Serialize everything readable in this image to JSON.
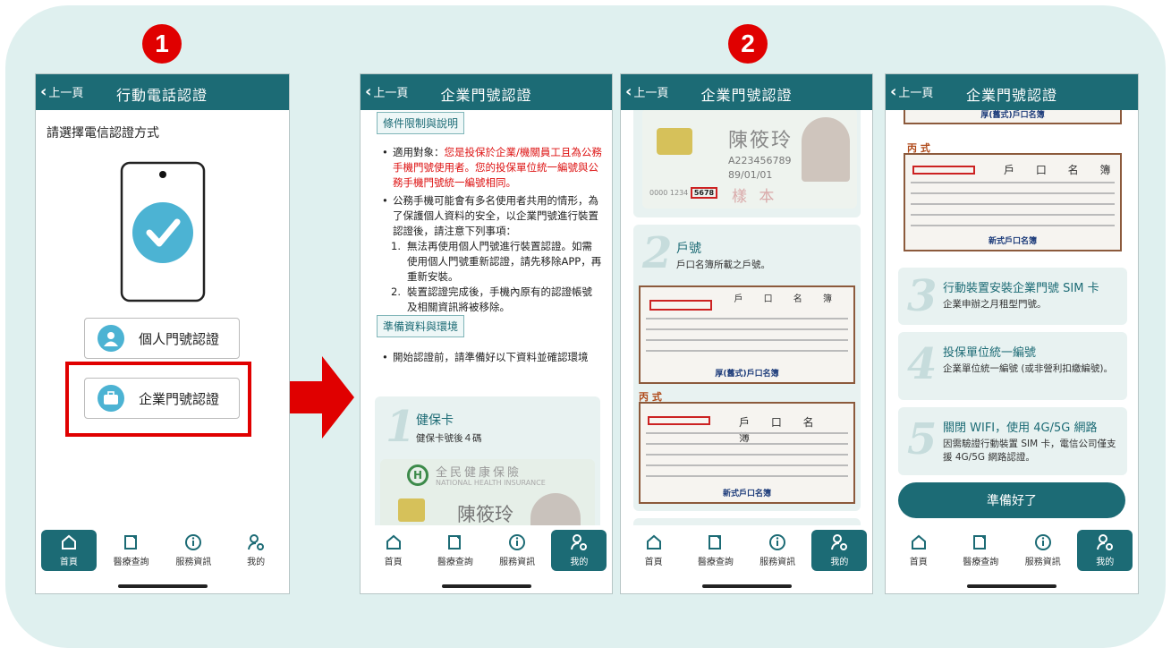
{
  "steps": {
    "one": "1",
    "two": "2"
  },
  "back_label": "上一頁",
  "tabs": [
    {
      "label": "首頁"
    },
    {
      "label": "醫療查詢"
    },
    {
      "label": "服務資訊"
    },
    {
      "label": "我的"
    }
  ],
  "screen1": {
    "title": "行動電話認證",
    "prompt": "請選擇電信認證方式",
    "options": {
      "personal": "個人門號認證",
      "enterprise": "企業門號認證"
    }
  },
  "screen2": {
    "title": "企業門號認證",
    "sec1": "條件限制與說明",
    "b1_pre": "適用對象：",
    "b1_red": "您是投保於企業/機關員工且為公務手機門號使用者。您的投保單位統一編號與公務手機門號統一編號相同。",
    "b2": "公務手機可能會有多名使用者共用的情形，為了保護個人資料的安全，以企業門號進行裝置認證後，請注意下列事項：",
    "n1": "無法再使用個人門號進行裝置認證。如需使用個人門號重新認證，請先移除APP，再重新安裝。",
    "n2": "裝置認證完成後，手機內原有的認證帳號及相關資訊將被移除。",
    "sec2": "準備資料與環境",
    "b3": "開始認證前，請準備好以下資料並確認環境",
    "card1": {
      "num": "1",
      "title": "健保卡",
      "sub": "健保卡號後４碼",
      "card_org": "全民健康保險",
      "card_en": "NATIONAL HEALTH INSURANCE",
      "name": "陳筱玲"
    }
  },
  "screen3": {
    "title": "企業門號認證",
    "id_name": "陳筱玲",
    "id_no": "A223456789",
    "id_dob": "89/01/01",
    "id_card_no": "0000 1234 ",
    "id_last4": "5678",
    "sample": "樣 本",
    "card2": {
      "num": "2",
      "title": "戶號",
      "sub": "戶口名簿所載之戶號。"
    },
    "doc_header": "戶 口 名 簿",
    "doc1_cap": "厚(舊式)戶口名簿",
    "doc2_label": "丙 式",
    "doc2_cap": "新式戶口名簿"
  },
  "screen4": {
    "title": "企業門號認證",
    "doc1_cap": "厚(舊式)戶口名簿",
    "doc2_label": "丙 式",
    "doc_header": "戶 口 名 簿",
    "doc2_cap": "新式戶口名簿",
    "card3": {
      "num": "3",
      "title": "行動裝置安裝企業門號 SIM 卡",
      "sub": "企業申辦之月租型門號。"
    },
    "card4": {
      "num": "4",
      "title": "投保單位統一編號",
      "sub": "企業單位統一編號 (或非營利扣繳編號)。"
    },
    "card5": {
      "num": "5",
      "title": "關閉 WIFI，使用 4G/5G 網路",
      "sub": "因需驗證行動裝置 SIM 卡，電信公司僅支援 4G/5G 網路認證。"
    },
    "ready": "準備好了"
  },
  "colors": {
    "teal": "#1c6b75",
    "red": "#e00000",
    "accent": "#4cb3d3"
  }
}
